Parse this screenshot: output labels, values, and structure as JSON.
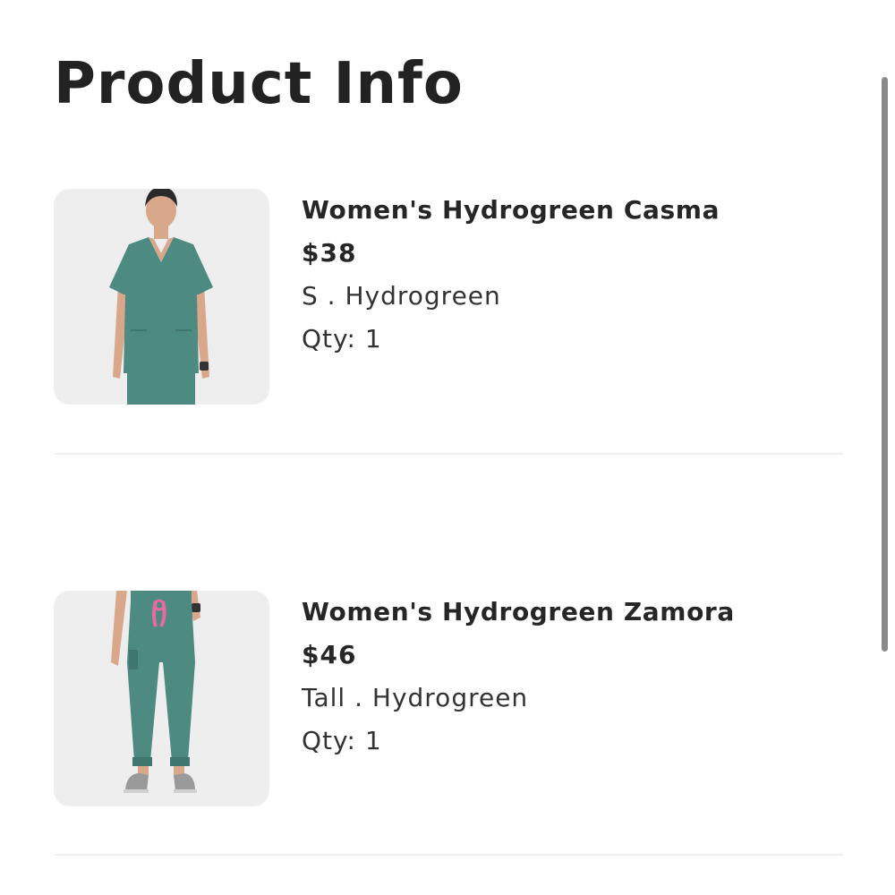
{
  "page": {
    "title": "Product Info"
  },
  "products": [
    {
      "name": "Women's Hydrogreen Casma",
      "price": "$38",
      "variant": "S . Hydrogreen",
      "qty": "Qty: 1",
      "image": "scrub-top-photo"
    },
    {
      "name": "Women's Hydrogreen Zamora",
      "price": "$46",
      "variant": "Tall . Hydrogreen",
      "qty": "Qty: 1",
      "image": "scrub-pants-photo"
    }
  ],
  "colors": {
    "product_teal": "#4d8a82",
    "drawstring_pink": "#e86aa0",
    "thumb_bg": "#eeeeee"
  }
}
